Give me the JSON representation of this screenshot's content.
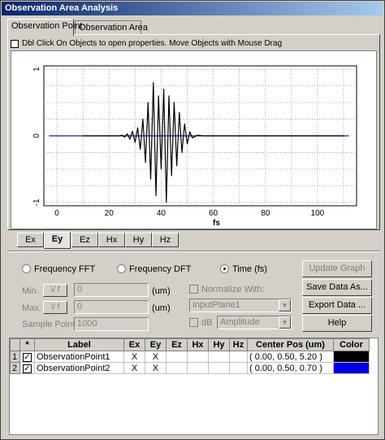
{
  "window": {
    "title": "Observation Area Analysis"
  },
  "tabs": [
    {
      "label": "Observation Point",
      "active": true
    },
    {
      "label": "Observation Area",
      "active": false
    }
  ],
  "hint": "Dbl Click On Objects to open properties.  Move Objects with Mouse Drag",
  "chart_data": {
    "type": "line",
    "title": "",
    "xlabel": "fs",
    "ylabel": "",
    "xlim": [
      -5,
      115
    ],
    "ylim": [
      -1.05,
      1.05
    ],
    "x_ticks": [
      "0",
      "20",
      "40",
      "60",
      "80",
      "100"
    ],
    "y_ticks": [
      "1",
      "0",
      "-1"
    ],
    "grid": true,
    "series": [
      {
        "color": "#000000",
        "x": [
          10,
          12,
          14,
          16,
          18,
          20,
          22,
          24,
          25,
          26,
          27,
          28,
          29,
          30,
          31,
          32,
          33,
          34,
          35,
          36,
          37,
          38,
          39,
          40,
          41,
          42,
          43,
          44,
          45,
          46,
          47,
          48,
          49,
          50,
          51,
          52,
          54,
          56,
          58,
          60,
          62,
          64,
          70,
          80,
          90,
          110
        ],
        "values": [
          0,
          0,
          0,
          0,
          0,
          0,
          0,
          0,
          0.01,
          -0.02,
          0.03,
          -0.05,
          0.07,
          -0.1,
          0.12,
          -0.2,
          0.25,
          -0.4,
          0.5,
          -0.65,
          0.8,
          -0.9,
          0.6,
          -0.5,
          0.7,
          -1.0,
          0.6,
          -0.6,
          0.5,
          -0.45,
          0.35,
          -0.25,
          0.18,
          -0.12,
          0.06,
          -0.03,
          0.01,
          0,
          0,
          0,
          0,
          0,
          0,
          0,
          0,
          0
        ]
      },
      {
        "color": "#1a1aa0",
        "x": [
          -3,
          112
        ],
        "values": [
          0,
          0
        ]
      }
    ]
  },
  "components": [
    {
      "label": "Ex",
      "active": false
    },
    {
      "label": "Ey",
      "active": true
    },
    {
      "label": "Ez",
      "active": false
    },
    {
      "label": "Hx",
      "active": false
    },
    {
      "label": "Hy",
      "active": false
    },
    {
      "label": "Hz",
      "active": false
    }
  ],
  "controls": {
    "radio_fft": "Frequency FFT",
    "radio_dft": "Frequency DFT",
    "radio_time": "Time (fs)",
    "min_label": "Min.",
    "max_label": "Max.",
    "unit_btn": "\\/ f",
    "min_value": "0",
    "max_value": "0",
    "unit": "(um)",
    "sample_points_label": "Sample Points:",
    "sample_points_value": "1000",
    "normalize_label": "Normalize With:",
    "plane_select": "InputPlane1",
    "db_label": "dB",
    "amplitude_select": "Amplitude"
  },
  "buttons": {
    "update_graph": "Update Graph",
    "save_data": "Save Data As...",
    "export_data": "Export Data ...",
    "help": "Help"
  },
  "table": {
    "headers": [
      "*",
      "Label",
      "Ex",
      "Ey",
      "Ez",
      "Hx",
      "Hy",
      "Hz",
      "Center Pos (um)",
      "Color"
    ],
    "rows": [
      {
        "num": "1",
        "label": "ObservationPoint1",
        "ex": "X",
        "ey": "X",
        "ez": "",
        "hx": "",
        "hy": "",
        "hz": "",
        "pos": "( 0.00, 0.50, 5.20 )",
        "color": "#000000"
      },
      {
        "num": "2",
        "label": "ObservationPoint2",
        "ex": "X",
        "ey": "X",
        "ez": "",
        "hx": "",
        "hy": "",
        "hz": "",
        "pos": "( 0.00, 0.50, 0.70 )",
        "color": "#0000e0"
      }
    ]
  }
}
